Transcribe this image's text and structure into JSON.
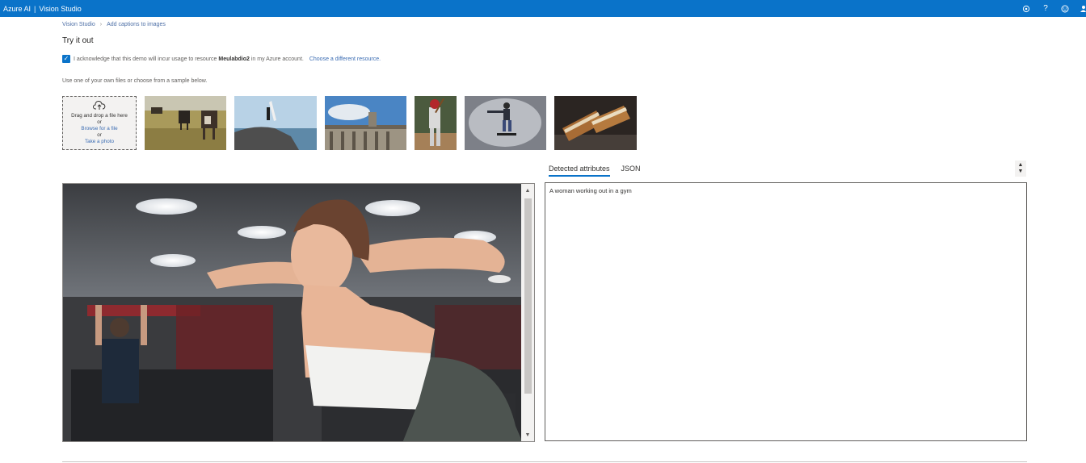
{
  "topbar": {
    "product": "Azure AI",
    "separator": "|",
    "app": "Vision Studio",
    "icons": [
      "settings-icon",
      "help-icon",
      "feedback-icon",
      "account-icon"
    ],
    "color": "#0a73c9"
  },
  "breadcrumb": {
    "root": "Vision Studio",
    "current": "Add captions to images"
  },
  "page": {
    "title": "Try it out"
  },
  "acknowledge": {
    "checked": true,
    "text_before": "I acknowledge that this demo will incur usage to resource",
    "resource": "Meulabdio2",
    "text_after": "in my Azure account.",
    "link": "Choose a different resource."
  },
  "hint": "Use one of your own files or choose from a sample below.",
  "upload": {
    "line1": "Drag and drop a file here",
    "or1": "or",
    "browse": "Browse for a file",
    "or2": "or",
    "photo": "Take a photo"
  },
  "samples": [
    {
      "name": "cows-in-field"
    },
    {
      "name": "surfer-on-rock"
    },
    {
      "name": "building-statues"
    },
    {
      "name": "baseball-batter"
    },
    {
      "name": "skateboarder"
    },
    {
      "name": "grilled-sandwich"
    }
  ],
  "tabs": [
    {
      "label": "Detected attributes",
      "active": true
    },
    {
      "label": "JSON",
      "active": false
    }
  ],
  "result": {
    "caption": "A woman working out in a gym"
  }
}
